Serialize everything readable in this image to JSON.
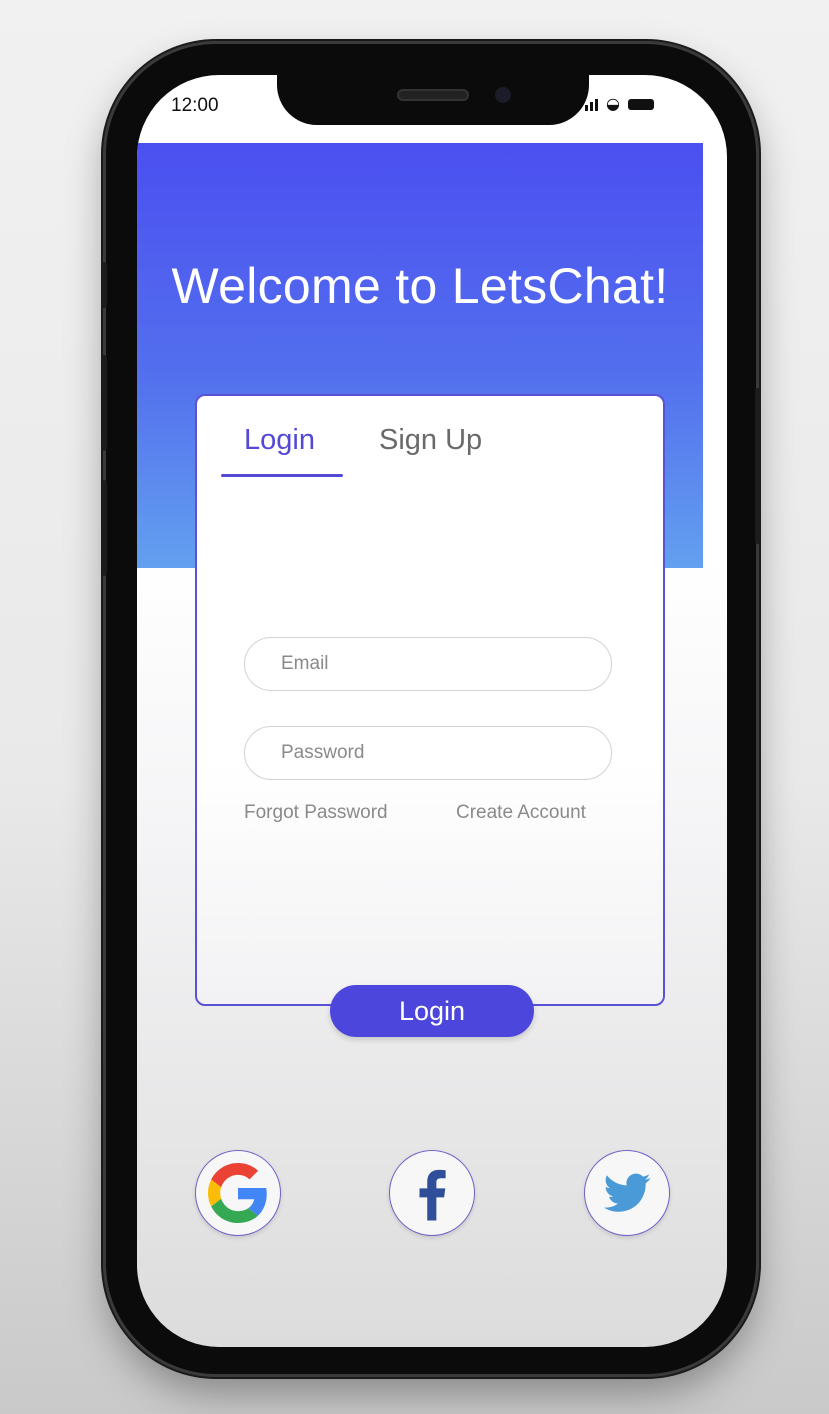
{
  "status_bar": {
    "time": "12:00"
  },
  "hero": {
    "title": "Welcome to LetsChat!"
  },
  "tabs": [
    {
      "label": "Login",
      "active": true
    },
    {
      "label": "Sign Up",
      "active": false
    }
  ],
  "form": {
    "email": {
      "placeholder": "Email",
      "value": ""
    },
    "password": {
      "placeholder": "Password",
      "value": ""
    },
    "forgot_password_label": "Forgot Password",
    "create_account_label": "Create Account",
    "login_button_label": "Login"
  },
  "social": [
    "google-icon",
    "facebook-icon",
    "twitter-icon"
  ],
  "colors": {
    "accent": "#4d46dc",
    "hero_top": "#4b4ff0",
    "hero_bottom": "#63a0ef"
  }
}
